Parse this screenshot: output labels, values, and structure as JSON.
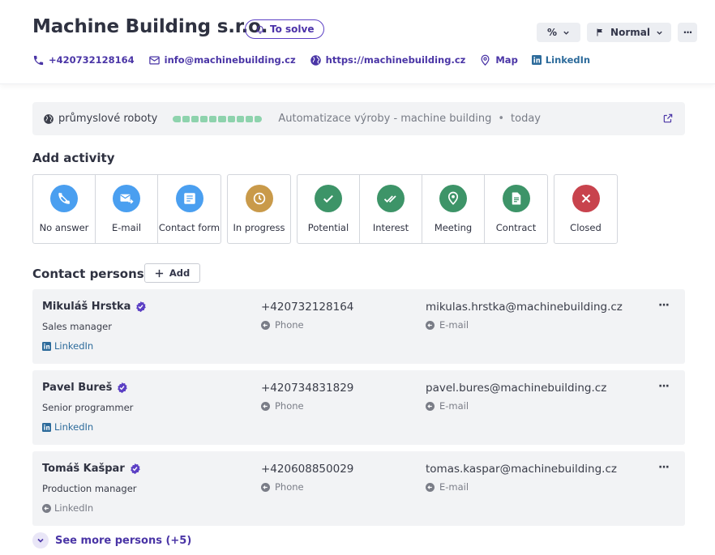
{
  "header": {
    "company_name": "Machine Building s.r.o.",
    "status_label": "To solve",
    "percent_dropdown_label": "%",
    "priority_dropdown_label": "Normal",
    "more_label": "···",
    "phone": "+420732128164",
    "email": "info@machinebuilding.cz",
    "website": "https://machinebuilding.cz",
    "map_label": "Map",
    "linkedin_label": "LinkedIn"
  },
  "info_bar": {
    "category": "průmyslové roboty",
    "progress_segments_filled": 10,
    "progress_segments_total": 10,
    "description": "Automatizace výroby - machine building",
    "separator": "•",
    "date": "today"
  },
  "add_activity": {
    "title": "Add activity",
    "groups": [
      [
        {
          "label": "No answer",
          "icon": "phone-missed-icon",
          "color": "#4a9ff0"
        },
        {
          "label": "E-mail",
          "icon": "mail-send-icon",
          "color": "#4a9ff0"
        },
        {
          "label": "Contact form",
          "icon": "form-icon",
          "color": "#4a9ff0"
        }
      ],
      [
        {
          "label": "In progress",
          "icon": "clock-icon",
          "color": "#c99a4a"
        }
      ],
      [
        {
          "label": "Potential",
          "icon": "check-icon",
          "color": "#3d9468"
        },
        {
          "label": "Interest",
          "icon": "double-check-icon",
          "color": "#3d9468"
        },
        {
          "label": "Meeting",
          "icon": "location-pin-icon",
          "color": "#3d9468"
        },
        {
          "label": "Contract",
          "icon": "document-icon",
          "color": "#3d9468"
        }
      ],
      [
        {
          "label": "Closed",
          "icon": "close-icon",
          "color": "#c8434d"
        }
      ]
    ]
  },
  "contacts": {
    "title": "Contact persons",
    "add_label": "Add",
    "phone_caption": "Phone",
    "email_caption": "E-mail",
    "persons": [
      {
        "name": "Mikuláš Hrstka",
        "role": "Sales manager",
        "linkedin": "LinkedIn",
        "linkedin_active": true,
        "phone": "+420732128164",
        "email": "mikulas.hrstka@machinebuilding.cz"
      },
      {
        "name": "Pavel Bureš",
        "role": "Senior programmer",
        "linkedin": "LinkedIn",
        "linkedin_active": true,
        "phone": "+420734831829",
        "email": "pavel.bures@machinebuilding.cz"
      },
      {
        "name": "Tomáš Kašpar",
        "role": "Production manager",
        "linkedin": "LinkedIn",
        "linkedin_active": false,
        "phone": "+420608850029",
        "email": "tomas.kaspar@machinebuilding.cz"
      }
    ],
    "more_label": "···",
    "see_more_label": "See more persons (+5)"
  },
  "colors": {
    "accent": "#4a35a6",
    "linkedin": "#2d6b9b",
    "progress": "#8ed3ad",
    "verified": "#5b3fc4"
  }
}
